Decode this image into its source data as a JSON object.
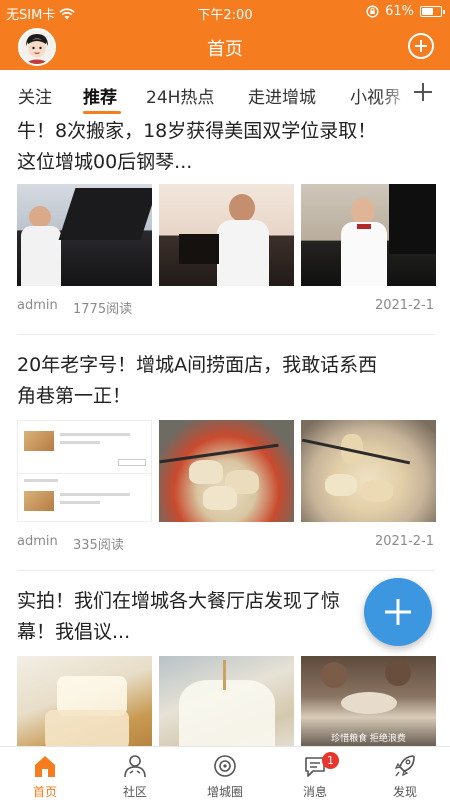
{
  "status_bar": {
    "carrier": "无SIM卡",
    "time": "下午2:00",
    "battery": "61%",
    "battery_level": 0.61
  },
  "header": {
    "title": "首页"
  },
  "tabs": [
    {
      "label": "关注"
    },
    {
      "label": "推荐"
    },
    {
      "label": "24H热点"
    },
    {
      "label": "走进增城"
    },
    {
      "label": "小视界"
    }
  ],
  "articles": [
    {
      "title_line1": "牛！8次搬家，18岁获得美国双学位录取！",
      "title_line2": "这位增城00后钢琴...",
      "author": "admin",
      "reads": "1775阅读",
      "date": "2021-2-1"
    },
    {
      "title_line1": "20年老字号！增城A间捞面店，我敢话系西",
      "title_line2": "角巷第一正！",
      "author": "admin",
      "reads": "335阅读",
      "date": "2021-2-1"
    },
    {
      "title_line1": "实拍！我们在增城各大餐厅店发现了惊",
      "title_line2": "幕！我倡议...",
      "banner_text": "珍惜粮食  拒绝浪费"
    }
  ],
  "bottom_nav": [
    {
      "label": "首页",
      "icon": "home-icon"
    },
    {
      "label": "社区",
      "icon": "community-icon"
    },
    {
      "label": "增城圈",
      "icon": "circle-icon"
    },
    {
      "label": "消息",
      "icon": "message-icon",
      "badge": "1"
    },
    {
      "label": "发现",
      "icon": "discover-icon"
    }
  ],
  "colors": {
    "brand": "#f57c1f",
    "fab": "#3c97e0",
    "badge": "#e8362c"
  }
}
